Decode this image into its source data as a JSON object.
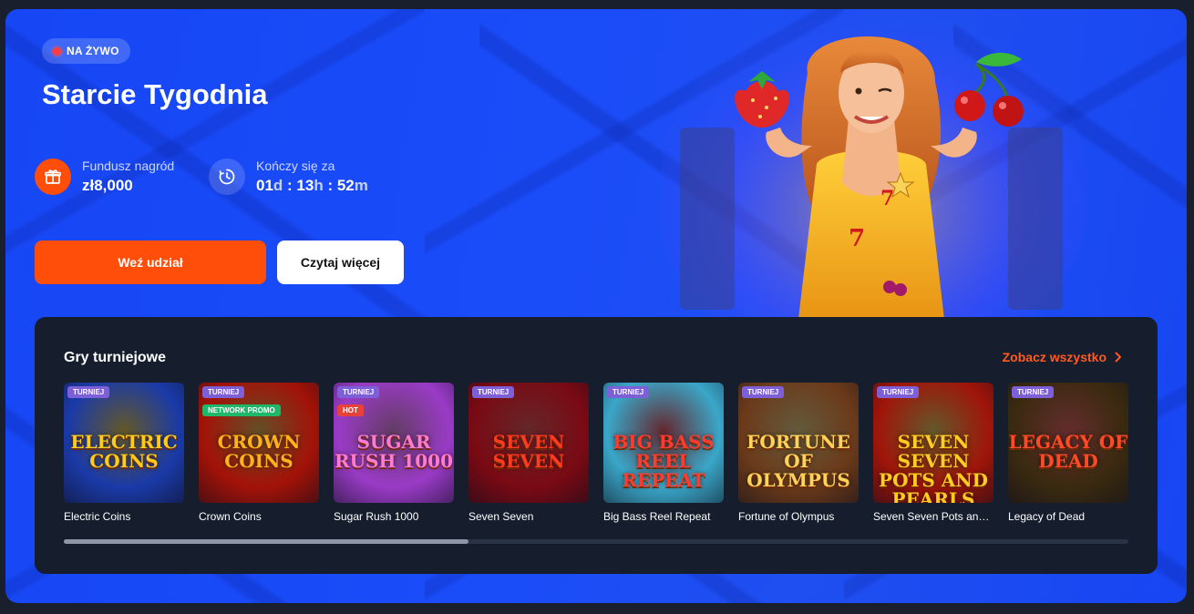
{
  "banner": {
    "live_label": "NA ŻYWO",
    "title": "Starcie Tygodnia",
    "prize": {
      "label": "Fundusz nagród",
      "value": "zł8,000",
      "icon": "gift-icon"
    },
    "timer": {
      "label": "Kończy się za",
      "days": "01",
      "days_unit": "d",
      "sep1": " : ",
      "hours": "13",
      "hours_unit": "h",
      "sep2": " : ",
      "minutes": "52",
      "minutes_unit": "m",
      "icon": "timer-icon"
    },
    "primary_button": "Weź udział",
    "secondary_button": "Czytaj więcej"
  },
  "games": {
    "title": "Gry turniejowe",
    "see_all": "Zobacz wszystko",
    "items": [
      {
        "name": "Electric Coins",
        "tag": "TURNIEJ",
        "subtag": "",
        "logo": "ELECTRIC COINS",
        "bg": "#1a3aa8",
        "accent": "#ffcc1a"
      },
      {
        "name": "Crown Coins",
        "tag": "TURNIEJ",
        "subtag": "NETWORK PROMO",
        "logo": "CROWN COINS",
        "bg": "#a31208",
        "accent": "#ffb21a"
      },
      {
        "name": "Sugar Rush 1000",
        "tag": "TURNIEJ",
        "subtag": "HOT",
        "logo": "SUGAR RUSH 1000",
        "bg": "#9a3bc7",
        "accent": "#ff7ad0"
      },
      {
        "name": "Seven Seven",
        "tag": "TURNIEJ",
        "subtag": "",
        "logo": "SEVEN SEVEN",
        "bg": "#7a0a14",
        "accent": "#ff3b1f"
      },
      {
        "name": "Big Bass Reel Repeat",
        "tag": "TURNIEJ",
        "subtag": "",
        "logo": "BIG BASS REEL REPEAT",
        "bg": "#3aa7c9",
        "accent": "#ff3b2f"
      },
      {
        "name": "Fortune of Olympus",
        "tag": "TURNIEJ",
        "subtag": "",
        "logo": "FORTUNE OF OLYMPUS",
        "bg": "#6b3a1a",
        "accent": "#ffd35a"
      },
      {
        "name": "Seven Seven Pots and Pearls",
        "tag": "TURNIEJ",
        "subtag": "",
        "logo": "SEVEN SEVEN POTS AND PEARLS",
        "bg": "#a0150a",
        "accent": "#ffcc22"
      },
      {
        "name": "Legacy of Dead",
        "tag": "TURNIEJ",
        "subtag": "",
        "logo": "LEGACY OF DEAD",
        "bg": "#3a2a10",
        "accent": "#ff4a2a"
      }
    ],
    "scroll_position": 0.38
  },
  "colors": {
    "banner_bg": "#1a4cf8",
    "primary": "#ff4d0a",
    "panel_bg": "#161e2e",
    "tag_bg": "#7d5fd8",
    "live_dot": "#ff3b3b"
  }
}
